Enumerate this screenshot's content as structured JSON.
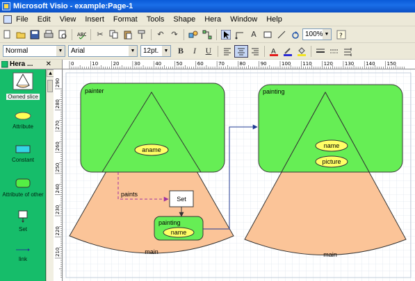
{
  "window": {
    "title": "Microsoft Visio - example:Page-1"
  },
  "menu": {
    "items": [
      "File",
      "Edit",
      "View",
      "Insert",
      "Format",
      "Tools",
      "Shape",
      "Hera",
      "Window",
      "Help"
    ]
  },
  "toolbar": {
    "zoom": "100%",
    "style": "Normal",
    "font": "Arial",
    "font_size": "12pt.",
    "bold": "B",
    "italic": "I",
    "underline": "U",
    "text_a": "A"
  },
  "stencil": {
    "title": "Hera ...",
    "close": "✕",
    "masters": [
      {
        "label": "Owned slice"
      },
      {
        "label": "Attribute"
      },
      {
        "label": "Constant"
      },
      {
        "label": "Attribute of other"
      },
      {
        "label": "Set"
      },
      {
        "label": "link"
      }
    ]
  },
  "ruler": {
    "top_labels": [
      "0",
      "10",
      "20",
      "30",
      "40",
      "50",
      "60",
      "70",
      "80",
      "90",
      "100",
      "110",
      "120",
      "130",
      "140",
      "150"
    ],
    "left_labels": [
      "290",
      "280",
      "270",
      "260",
      "250",
      "240",
      "230",
      "220",
      "210"
    ]
  },
  "drawing": {
    "left_group": {
      "slice_label": "painter",
      "slice_attribute": "aname",
      "base_label": "main",
      "link_label": "paints",
      "set_label": "Set",
      "sub_slice_label": "painting",
      "sub_slice_attribute": "name"
    },
    "right_group": {
      "slice_label": "painting",
      "attr1": "name",
      "attr2": "picture",
      "base_label": "main"
    }
  },
  "colors": {
    "slice_green": "#66ee55",
    "cone_fill": "#fbc498",
    "attribute_yellow": "#ffff66",
    "stencil_green": "#16bd6a",
    "link_blue": "#1f3a93",
    "link_purple": "#a0329f"
  }
}
